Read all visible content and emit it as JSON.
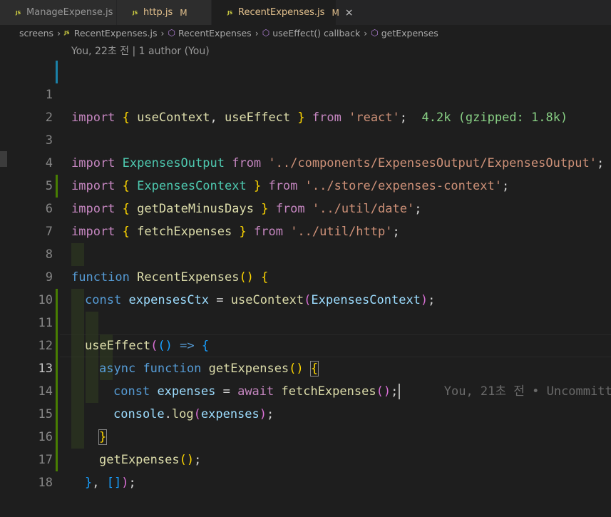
{
  "tabs": [
    {
      "label": "ManageExpense.js",
      "modified": "",
      "active": false
    },
    {
      "label": "http.js",
      "modified": "M",
      "active": false
    },
    {
      "label": "RecentExpenses.js",
      "modified": "M",
      "active": true
    }
  ],
  "tab_close": "×",
  "breadcrumb": [
    "screens",
    "RecentExpenses.js",
    "RecentExpenses",
    "useEffect() callback",
    "getExpenses"
  ],
  "blame_header": "You, 22초 전 | 1 author (You)",
  "import_cost": "4.2k (gzipped: 1.8k)",
  "inline_blame": "You, 21초 전 • Uncommitt",
  "line_numbers": [
    "1",
    "2",
    "3",
    "4",
    "5",
    "6",
    "7",
    "8",
    "9",
    "10",
    "11",
    "12",
    "13",
    "14",
    "15",
    "16",
    "17",
    "18"
  ],
  "current_line": "13",
  "colors": {
    "editor_bg": "#1e1e1e",
    "keyword": "#569cd6",
    "control": "#c586c0",
    "function": "#dcdcaa",
    "string": "#ce9178",
    "variable": "#9cdcfe",
    "class": "#4ec9b0",
    "modified_tab": "#e2c08d"
  },
  "code": {
    "l1": {
      "kw": "import",
      "b1": "{",
      "a": "useContext",
      "c": ",",
      "b": "useEffect",
      "b2": "}",
      "from": "from",
      "str": "'react'",
      "semi": ";"
    },
    "l3": {
      "kw": "import",
      "a": "ExpensesOutput",
      "from": "from",
      "str": "'../components/ExpensesOutput/ExpensesOutput'",
      "semi": ";"
    },
    "l4": {
      "kw": "import",
      "b1": "{",
      "a": "ExpensesContext",
      "b2": "}",
      "from": "from",
      "str": "'../store/expenses-context'",
      "semi": ";"
    },
    "l5": {
      "kw": "import",
      "b1": "{",
      "a": "getDateMinusDays",
      "b2": "}",
      "from": "from",
      "str": "'../util/date'",
      "semi": ";"
    },
    "l6": {
      "kw": "import",
      "b1": "{",
      "a": "fetchExpenses",
      "b2": "}",
      "from": "from",
      "str": "'../util/http'",
      "semi": ";"
    },
    "l8": {
      "kw": "function",
      "name": "RecentExpenses",
      "p": "()",
      "b": "{"
    },
    "l9": {
      "kw": "const",
      "v": "expensesCtx",
      "eq": "=",
      "fn": "useContext",
      "p1": "(",
      "arg": "ExpensesContext",
      "p2": ")",
      "semi": ";"
    },
    "l11": {
      "fn": "useEffect",
      "p1": "(",
      "p2": "()",
      "arrow": "=>",
      "b": "{"
    },
    "l12": {
      "kw1": "async",
      "kw2": "function",
      "name": "getExpenses",
      "p": "()",
      "b": "{"
    },
    "l13": {
      "kw": "const",
      "v": "expenses",
      "eq": "=",
      "aw": "await",
      "fn": "fetchExpenses",
      "p": "()",
      "semi": ";"
    },
    "l14": {
      "obj": "console",
      "dot": ".",
      "fn": "log",
      "p1": "(",
      "arg": "expenses",
      "p2": ")",
      "semi": ";"
    },
    "l15": {
      "b": "}"
    },
    "l16": {
      "fn": "getExpenses",
      "p": "()",
      "semi": ";"
    },
    "l17": {
      "b": "}",
      "c": ",",
      "arr": "[]",
      "p": ")",
      "semi": ";"
    }
  }
}
